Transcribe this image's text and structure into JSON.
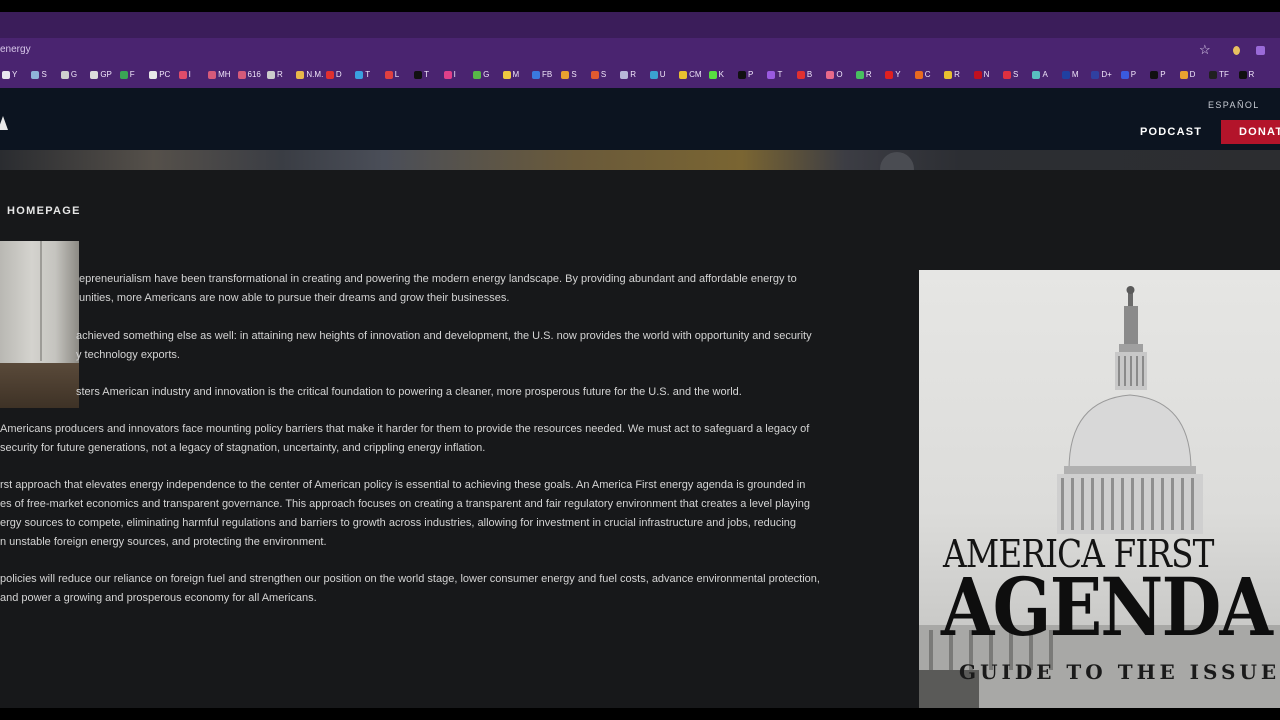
{
  "browser": {
    "url": "energy",
    "bookmarks": [
      {
        "label": "Y",
        "color": "#e8e8f0"
      },
      {
        "label": "S",
        "color": "#8fb3d9"
      },
      {
        "label": "G",
        "color": "#cfcfcf"
      },
      {
        "label": "GP",
        "color": "#dcdcdc"
      },
      {
        "label": "F",
        "color": "#3aa655"
      },
      {
        "label": "PC",
        "color": "#e8e8e8"
      },
      {
        "label": "I",
        "color": "#e04c6a"
      },
      {
        "label": "MH",
        "color": "#d65a7a"
      },
      {
        "label": "616",
        "color": "#d65a7a"
      },
      {
        "label": "R",
        "color": "#cccccc"
      },
      {
        "label": "N.M.",
        "color": "#e8b84a"
      },
      {
        "label": "D",
        "color": "#e03030"
      },
      {
        "label": "T",
        "color": "#3aa0e0"
      },
      {
        "label": "L",
        "color": "#e04040"
      },
      {
        "label": "T",
        "color": "#111111"
      },
      {
        "label": "I",
        "color": "#e0408a"
      },
      {
        "label": "G",
        "color": "#58b848"
      },
      {
        "label": "M",
        "color": "#f0c840"
      },
      {
        "label": "FB",
        "color": "#3a78e0"
      },
      {
        "label": "S",
        "color": "#e8a030"
      },
      {
        "label": "S",
        "color": "#e05a30"
      },
      {
        "label": "R",
        "color": "#b8b8d8"
      },
      {
        "label": "U",
        "color": "#3aa0d0"
      },
      {
        "label": "CM",
        "color": "#e8c030"
      },
      {
        "label": "K",
        "color": "#58e040"
      },
      {
        "label": "P",
        "color": "#111111"
      },
      {
        "label": "T",
        "color": "#9a5ae0"
      },
      {
        "label": "B",
        "color": "#e03030"
      },
      {
        "label": "O",
        "color": "#e86a8a"
      },
      {
        "label": "R",
        "color": "#48c060"
      },
      {
        "label": "Y",
        "color": "#e02020"
      },
      {
        "label": "C",
        "color": "#e86a20"
      },
      {
        "label": "R",
        "color": "#e8c030"
      },
      {
        "label": "N",
        "color": "#c01020"
      },
      {
        "label": "S",
        "color": "#e03040"
      },
      {
        "label": "A",
        "color": "#58c0c0"
      },
      {
        "label": "M",
        "color": "#2040a0"
      },
      {
        "label": "D+",
        "color": "#3040a0"
      },
      {
        "label": "P",
        "color": "#3a5ae0"
      },
      {
        "label": "P",
        "color": "#101010"
      },
      {
        "label": "D",
        "color": "#e8a030"
      },
      {
        "label": "TF",
        "color": "#202020"
      },
      {
        "label": "R",
        "color": "#101010"
      }
    ]
  },
  "site": {
    "lang_toggle": "ESPAÑOL",
    "nav_podcast": "PODCAST",
    "nav_donate": "DONAT",
    "breadcrumb": "HOMEPAGE"
  },
  "article": {
    "p1": [
      "epreneurialism have been transformational in creating and powering the modern energy landscape. By providing abundant and affordable energy to",
      "unities, more Americans are now able to pursue their dreams and grow their businesses."
    ],
    "p2": [
      "achieved something else as well: in attaining new heights of innovation and development, the U.S. now provides the world with opportunity and security",
      "y technology exports."
    ],
    "p3": [
      "sters American industry and innovation is the critical foundation to powering a cleaner, more prosperous future for the U.S. and the world."
    ],
    "p4": [
      " Americans producers and innovators face mounting policy barriers that make it harder for them to provide the resources needed. We must act to safeguard a legacy of",
      " security for future generations, not a legacy of stagnation, uncertainty, and crippling energy inflation."
    ],
    "p5": [
      "rst approach that elevates energy independence to the center of American policy is essential to achieving these goals. An America First energy agenda is grounded in",
      "es of free-market economics and transparent governance. This approach focuses on creating a transparent and fair regulatory environment that creates a level playing",
      "ergy sources to compete, eliminating harmful regulations and barriers to growth across industries, allowing for investment in crucial infrastructure and jobs, reducing",
      "n unstable foreign energy sources, and protecting the environment."
    ],
    "p6": [
      "policies will reduce our reliance on foreign fuel and strengthen our position on the world stage, lower consumer energy and fuel costs, advance environmental protection,",
      "and power a growing and prosperous economy for all Americans."
    ]
  },
  "poster": {
    "line1": "AMERICA FIRST",
    "line2": "AGENDA",
    "line3": "GUIDE TO THE ISSUE"
  },
  "icons": {
    "bookmark_star": "star-icon",
    "logo": "triangle-logo-icon"
  }
}
